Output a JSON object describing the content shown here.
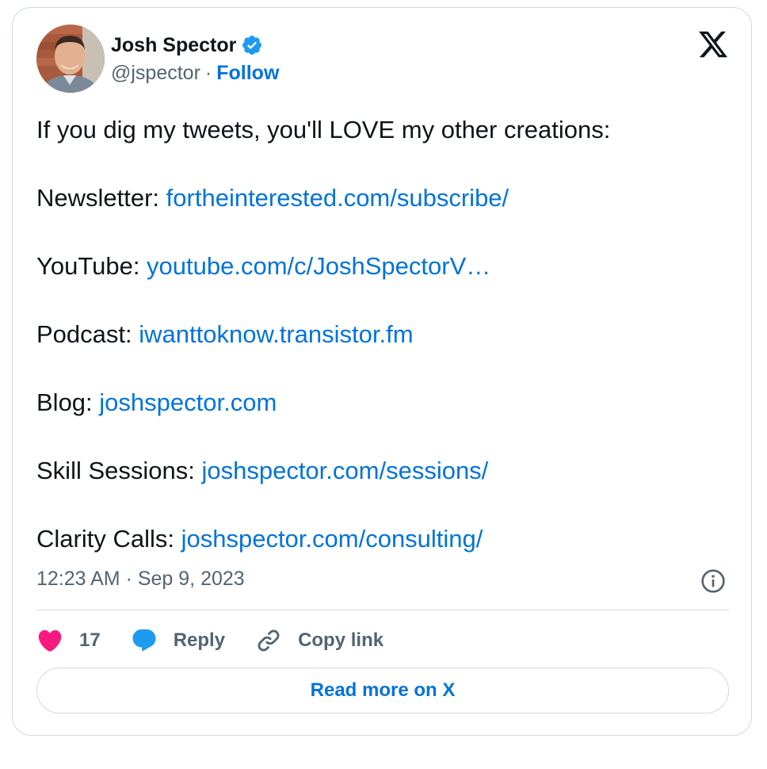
{
  "author": {
    "name": "Josh Spector",
    "handle": "@jspector",
    "separator": "·",
    "follow_label": "Follow"
  },
  "tweet": {
    "lines": [
      {
        "text": "If you dig my tweets, you'll LOVE my other creations:"
      },
      {
        "label": "Newsletter: ",
        "link": "fortheinterested.com/subscribe/"
      },
      {
        "label": "YouTube: ",
        "link": "youtube.com/c/JoshSpectorV…"
      },
      {
        "label": "Podcast: ",
        "link": "iwanttoknow.transistor.fm"
      },
      {
        "label": "Blog: ",
        "link": "joshspector.com"
      },
      {
        "label": "Skill Sessions: ",
        "link": "joshspector.com/sessions/"
      },
      {
        "label": "Clarity Calls: ",
        "link": "joshspector.com/consulting/"
      }
    ],
    "timestamp": "12:23 AM · Sep 9, 2023"
  },
  "actions": {
    "like_count": "17",
    "reply_label": "Reply",
    "copy_label": "Copy link",
    "read_more_label": "Read more on X"
  },
  "colors": {
    "link": "#0073db",
    "like": "#f91880",
    "reply": "#1d9bf0",
    "verified": "#1d9bf0"
  },
  "icons": [
    "verified-badge-icon",
    "x-logo-icon",
    "info-icon",
    "heart-icon",
    "reply-bubble-icon",
    "link-icon"
  ]
}
